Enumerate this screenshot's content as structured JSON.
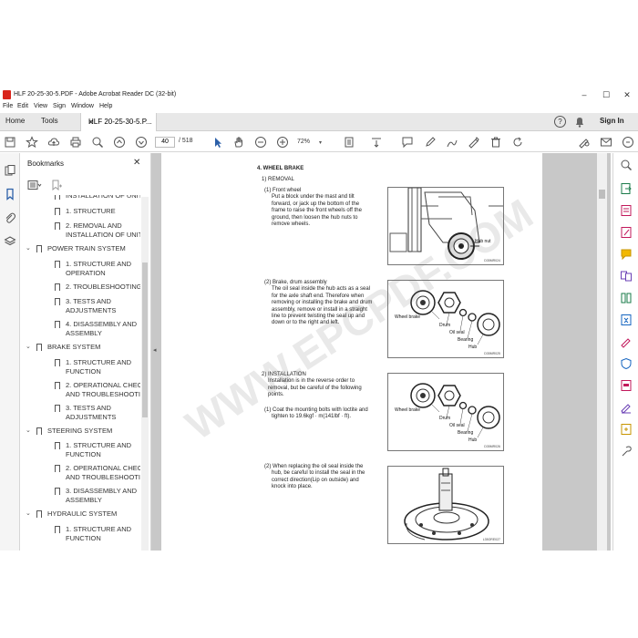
{
  "window": {
    "title": "HLF 20-25-30-5.PDF - Adobe Acrobat Reader DC (32-bit)",
    "controls": [
      "–",
      "☐",
      "✕"
    ]
  },
  "menu": [
    "File",
    "Edit",
    "View",
    "Sign",
    "Window",
    "Help"
  ],
  "tabs": {
    "home": "Home",
    "tools": "Tools",
    "document": "HLF 20-25-30-5.P...",
    "close": "×",
    "help": "?",
    "sign_in": "Sign In"
  },
  "toolbar": {
    "page_current": "40",
    "page_total": "/ 518",
    "zoom": "72%"
  },
  "bookmarks": {
    "title": "Bookmarks",
    "close": "✕",
    "items": [
      {
        "text": "INSTALLATION OF UNIT",
        "level": 2
      },
      {
        "text": "1. STRUCTURE",
        "level": 2
      },
      {
        "text": "2. REMOVAL AND",
        "text2": "INSTALLATION OF UNIT",
        "level": 2
      },
      {
        "text": "POWER TRAIN SYSTEM",
        "level": 1
      },
      {
        "text": "1. STRUCTURE AND",
        "text2": "OPERATION",
        "level": 2
      },
      {
        "text": "2. TROUBLESHOOTING",
        "level": 2
      },
      {
        "text": "3. TESTS AND",
        "text2": "ADJUSTMENTS",
        "level": 2
      },
      {
        "text": "4. DISASSEMBLY AND",
        "text2": "ASSEMBLY",
        "level": 2
      },
      {
        "text": "BRAKE SYSTEM",
        "level": 1
      },
      {
        "text": "1. STRUCTURE AND",
        "text2": "FUNCTION",
        "level": 2
      },
      {
        "text": "2. OPERATIONAL CHECKS",
        "text2": "AND TROUBLESHOOTING",
        "level": 2
      },
      {
        "text": "3. TESTS AND",
        "text2": "ADJUSTMENTS",
        "level": 2
      },
      {
        "text": "STEERING SYSTEM",
        "level": 1
      },
      {
        "text": "1. STRUCTURE AND",
        "text2": "FUNCTION",
        "level": 2
      },
      {
        "text": "2. OPERATIONAL CHECKS",
        "text2": "AND TROUBLESHOOTING",
        "level": 2
      },
      {
        "text": "3. DISASSEMBLY AND",
        "text2": "ASSEMBLY",
        "level": 2
      },
      {
        "text": "HYDRAULIC SYSTEM",
        "level": 1
      },
      {
        "text": "1. STRUCTURE AND",
        "text2": "FUNCTION",
        "level": 2
      }
    ]
  },
  "page": {
    "heading": "4. WHEEL BRAKE",
    "removal": "1)  REMOVAL",
    "front_wheel_title": "(1)  Front wheel",
    "front_wheel_lines": [
      "Put a block under the mast and tilt",
      "forward, or jack up the bottom of the",
      "frame to raise the front wheels off the",
      "ground, then loosen the hub nuts to",
      "remove wheels."
    ],
    "brake_title": "(2)  Brake, drum assembly",
    "brake_lines": [
      "The oil seal inside the hub acts as a seal",
      "for the axle shaft end. Therefore when",
      "removing or installing the brake and drum",
      "assembly, remove or install in a straight",
      "line to prevent twisting the seal up and",
      "down or to the right and left."
    ],
    "installation": "2)  INSTALLATION",
    "installation_lines": [
      "Installation is in the reverse order to",
      "removal, but be careful of the following",
      "points."
    ],
    "coat_title": "(1)  Coat the mounting bolts with loctite and",
    "coat_lines": [
      "tighten to 19.6kgf · m(141lbf · ft)."
    ],
    "seal_title": "(2)  When replacing the oil seal inside the",
    "seal_lines": [
      "hub, be careful to install the seal in the",
      "correct direction(Lip on outside) and",
      "knock into place."
    ],
    "fig1_label": "Hub nut",
    "fig1_code": "D35MR024",
    "fig2_labels": [
      "Wheel brake",
      "Drum",
      "Oil seal",
      "Bearing",
      "Hub"
    ],
    "fig2_code": "D35MR025",
    "fig3_labels": [
      "Wheel brake",
      "Drum",
      "Oil seal",
      "Bearing",
      "Hub"
    ],
    "fig3_code": "D35MR026",
    "fig4_code": "L35ORE027",
    "watermark": "WWW.EPCPDF.COM"
  },
  "colors": {
    "accent": "#d9251c",
    "sign_in_icon": "#2680eb"
  }
}
